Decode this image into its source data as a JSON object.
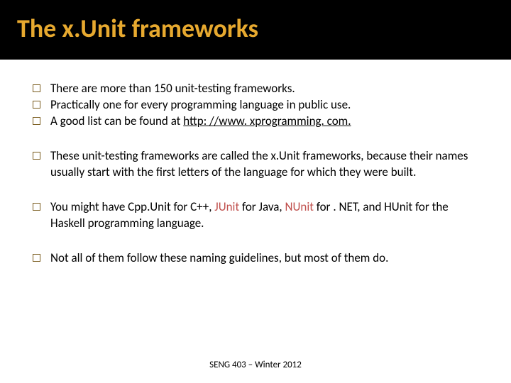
{
  "title": "The x.Unit frameworks",
  "groups": [
    {
      "items": [
        {
          "segments": [
            {
              "t": "There are more than 150 unit-testing frameworks."
            }
          ]
        },
        {
          "segments": [
            {
              "t": "Practically one for every programming language in public use."
            }
          ]
        },
        {
          "segments": [
            {
              "t": "A good list can be found at "
            },
            {
              "t": "http: //www. xprogramming. com.",
              "link": true
            }
          ]
        }
      ]
    },
    {
      "items": [
        {
          "segments": [
            {
              "t": "These unit-testing frameworks are called the x.Unit frameworks, because their names usually start with the first letters of the language for which they were built."
            }
          ]
        }
      ]
    },
    {
      "items": [
        {
          "segments": [
            {
              "t": "You might have Cpp.Unit for C++, "
            },
            {
              "t": "JUnit",
              "accent": true
            },
            {
              "t": " for Java, "
            },
            {
              "t": "NUnit",
              "accent": true
            },
            {
              "t": " for . NET, and HUnit for the Haskell programming language."
            }
          ]
        }
      ]
    },
    {
      "items": [
        {
          "segments": [
            {
              "t": "Not all of them follow these naming guidelines, but most of them do."
            }
          ]
        }
      ]
    }
  ],
  "footer": "SENG 403 – Winter 2012"
}
